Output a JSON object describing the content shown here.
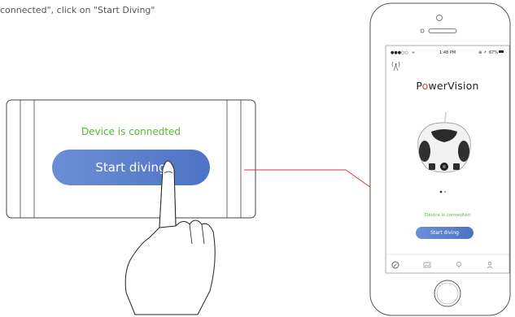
{
  "instruction": "connected\", click on \"Start Diving\"",
  "zoom": {
    "status_text": "Device is connedted",
    "button_label": "Start diving"
  },
  "phone": {
    "status_bar": {
      "carrier": "●●●○○",
      "time": "1:48 PM",
      "battery": "67%"
    },
    "brand": {
      "before_o": "P",
      "o": "o",
      "after_o": "werVision"
    },
    "status_text": "Device is connedted",
    "button_label": "Start diving",
    "page_dots": 2,
    "active_dot": 0,
    "tabs": [
      "compass-icon",
      "gallery-icon",
      "bulb-icon",
      "person-icon"
    ]
  },
  "colors": {
    "status_green": "#57b833",
    "button_blue": "#5a7fcb",
    "connector_red": "#d93a3a",
    "brand_o_red": "#d8403b"
  }
}
